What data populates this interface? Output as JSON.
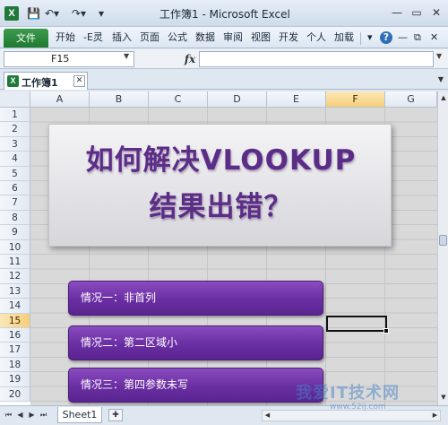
{
  "window": {
    "title": "工作簿1 - Microsoft Excel",
    "app_icon": "X",
    "controls": [
      "—",
      "▭",
      "✕"
    ]
  },
  "quick_access": [
    "save-icon",
    "undo-icon",
    "redo-icon",
    "customize-icon"
  ],
  "ribbon": {
    "file_tab": "文件",
    "tabs": [
      "开始",
      "-E灵",
      "插入",
      "页面",
      "公式",
      "数据",
      "审阅",
      "视图",
      "开发",
      "个人",
      "加载"
    ],
    "right_icons": [
      "▾",
      "?",
      "—",
      "⧉",
      "✕"
    ]
  },
  "formula_bar": {
    "name_box": "F15",
    "fx": "fx",
    "value": ""
  },
  "document_tab": {
    "label": "工作簿1",
    "close": "✕"
  },
  "columns": [
    {
      "label": "A",
      "selected": false
    },
    {
      "label": "B",
      "selected": false
    },
    {
      "label": "C",
      "selected": false
    },
    {
      "label": "D",
      "selected": false
    },
    {
      "label": "E",
      "selected": false
    },
    {
      "label": "F",
      "selected": true
    },
    {
      "label": "G",
      "selected": false
    }
  ],
  "rows": [
    "1",
    "2",
    "3",
    "4",
    "5",
    "6",
    "7",
    "8",
    "9",
    "10",
    "11",
    "12",
    "13",
    "14",
    "15",
    "16",
    "17",
    "18",
    "19",
    "20"
  ],
  "selected_row": "15",
  "title_shape": {
    "line1": "如何解决VLOOKUP",
    "line2": "结果出错？",
    "color": "#5b2d86"
  },
  "case_buttons": [
    "情况一：非首列",
    "情况二：第二区域小",
    "情况三：第四参数未写"
  ],
  "sheet_tabs": {
    "active": "Sheet1"
  },
  "watermark": {
    "text": "我爱IT技术网",
    "sub": "www.52ij.com"
  }
}
